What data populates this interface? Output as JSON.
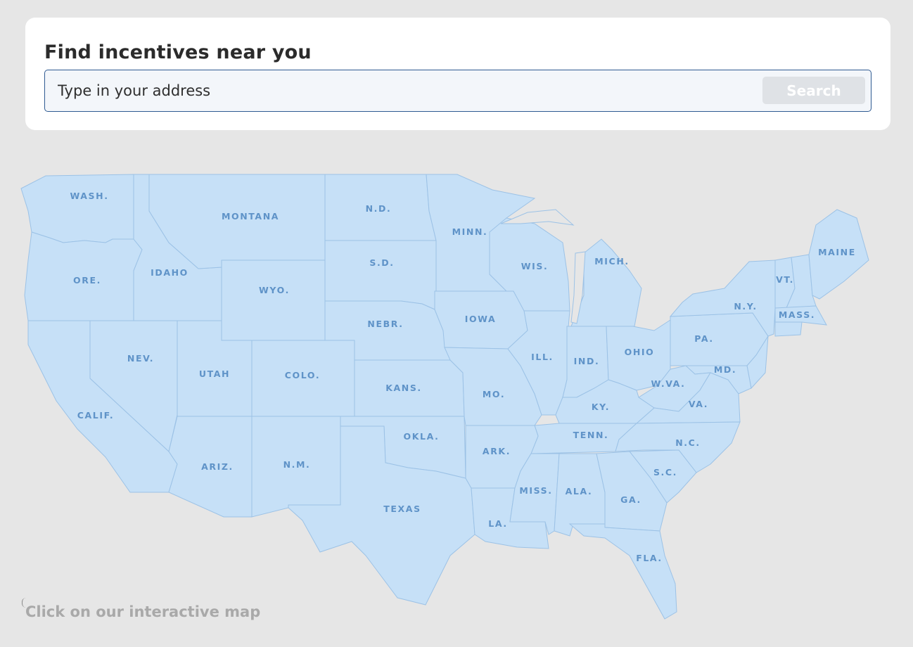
{
  "search": {
    "title": "Find incentives near you",
    "placeholder": "Type in your address",
    "button_label": "Search"
  },
  "map": {
    "hint": "Click on our interactive map",
    "fill_color": "#c6e0f7",
    "stroke_color": "#9cc2e6",
    "label_color": "#5f93c8",
    "states": [
      {
        "id": "wa",
        "label": "WASH."
      },
      {
        "id": "mt",
        "label": "MONTANA"
      },
      {
        "id": "nd",
        "label": "N.D."
      },
      {
        "id": "mn",
        "label": "MINN."
      },
      {
        "id": "me",
        "label": "MAINE"
      },
      {
        "id": "or",
        "label": "ORE."
      },
      {
        "id": "id",
        "label": "IDAHO"
      },
      {
        "id": "wy",
        "label": "WYO."
      },
      {
        "id": "sd",
        "label": "S.D."
      },
      {
        "id": "wi",
        "label": "WIS."
      },
      {
        "id": "mi",
        "label": "MICH."
      },
      {
        "id": "vt",
        "label": "VT."
      },
      {
        "id": "ny",
        "label": "N.Y."
      },
      {
        "id": "ma",
        "label": "MASS."
      },
      {
        "id": "ne",
        "label": "NEBR."
      },
      {
        "id": "ia",
        "label": "IOWA"
      },
      {
        "id": "pa",
        "label": "PA."
      },
      {
        "id": "nv",
        "label": "NEV."
      },
      {
        "id": "ut",
        "label": "UTAH"
      },
      {
        "id": "co",
        "label": "COLO."
      },
      {
        "id": "il",
        "label": "ILL."
      },
      {
        "id": "in",
        "label": "IND."
      },
      {
        "id": "oh",
        "label": "OHIO"
      },
      {
        "id": "md",
        "label": "MD."
      },
      {
        "id": "wv",
        "label": "W.VA."
      },
      {
        "id": "ks",
        "label": "KANS."
      },
      {
        "id": "mo",
        "label": "MO."
      },
      {
        "id": "ky",
        "label": "KY."
      },
      {
        "id": "va",
        "label": "VA."
      },
      {
        "id": "ca",
        "label": "CALIF."
      },
      {
        "id": "ok",
        "label": "OKLA."
      },
      {
        "id": "tn",
        "label": "TENN."
      },
      {
        "id": "nc",
        "label": "N.C."
      },
      {
        "id": "ar",
        "label": "ARK."
      },
      {
        "id": "sc",
        "label": "S.C."
      },
      {
        "id": "az",
        "label": "ARIZ."
      },
      {
        "id": "nm",
        "label": "N.M."
      },
      {
        "id": "ms",
        "label": "MISS."
      },
      {
        "id": "al",
        "label": "ALA."
      },
      {
        "id": "ga",
        "label": "GA."
      },
      {
        "id": "tx",
        "label": "TEXAS"
      },
      {
        "id": "la",
        "label": "LA."
      },
      {
        "id": "fl",
        "label": "FLA."
      }
    ]
  }
}
